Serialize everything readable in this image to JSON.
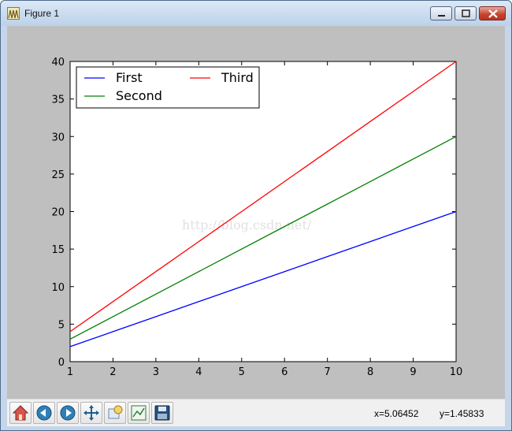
{
  "window": {
    "title": "Figure 1"
  },
  "toolbar": {
    "tools": [
      "home-icon",
      "back-icon",
      "forward-icon",
      "pan-icon",
      "zoom-icon",
      "configure-subplots-icon",
      "save-icon"
    ],
    "x_readout": "x=5.06452",
    "y_readout": "y=1.45833"
  },
  "watermark": "http://blog.csdn.net/",
  "colors": {
    "first": "#0000ff",
    "second": "#008000",
    "third": "#ff0000",
    "figure_bg": "#bfbfbf",
    "axes_bg": "#ffffff"
  },
  "chart_data": {
    "type": "line",
    "title": "",
    "xlabel": "",
    "ylabel": "",
    "xlim": [
      1,
      10
    ],
    "ylim": [
      0,
      40
    ],
    "xticks": [
      1,
      2,
      3,
      4,
      5,
      6,
      7,
      8,
      9,
      10
    ],
    "yticks": [
      0,
      5,
      10,
      15,
      20,
      25,
      30,
      35,
      40
    ],
    "grid": false,
    "legend_placement": "upper-left",
    "legend_columns": 2,
    "series": [
      {
        "name": "First",
        "color": "#0000ff",
        "x": [
          1,
          2,
          3,
          4,
          5,
          6,
          7,
          8,
          9,
          10
        ],
        "y": [
          2,
          4,
          6,
          8,
          10,
          12,
          14,
          16,
          18,
          20
        ]
      },
      {
        "name": "Second",
        "color": "#008000",
        "x": [
          1,
          2,
          3,
          4,
          5,
          6,
          7,
          8,
          9,
          10
        ],
        "y": [
          3,
          6,
          9,
          12,
          15,
          18,
          21,
          24,
          27,
          30
        ]
      },
      {
        "name": "Third",
        "color": "#ff0000",
        "x": [
          1,
          2,
          3,
          4,
          5,
          6,
          7,
          8,
          9,
          10
        ],
        "y": [
          4,
          8,
          12,
          16,
          20,
          24,
          28,
          32,
          36,
          40
        ]
      }
    ]
  }
}
